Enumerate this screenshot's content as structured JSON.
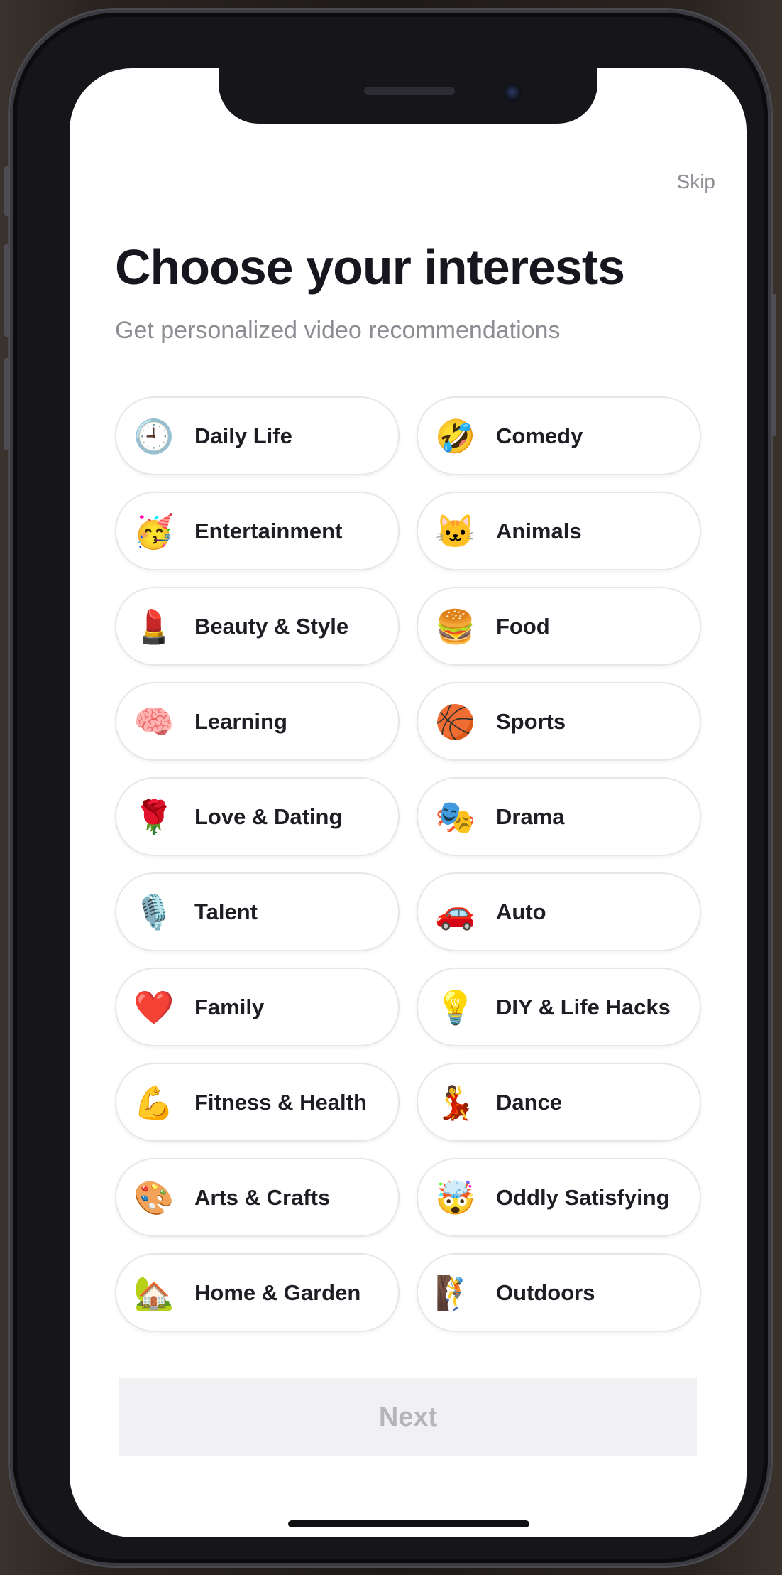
{
  "header": {
    "skip_label": "Skip",
    "title": "Choose your interests",
    "subtitle": "Get personalized video recommendations"
  },
  "interests": [
    {
      "label": "Daily Life",
      "emoji": "🕘",
      "icon": "clock-icon"
    },
    {
      "label": "Comedy",
      "emoji": "🤣",
      "icon": "laughing-face-icon"
    },
    {
      "label": "Entertainment",
      "emoji": "🥳",
      "icon": "party-face-icon"
    },
    {
      "label": "Animals",
      "emoji": "🐱",
      "icon": "cat-face-icon"
    },
    {
      "label": "Beauty & Style",
      "emoji": "💄",
      "icon": "lipstick-icon"
    },
    {
      "label": "Food",
      "emoji": "🍔",
      "icon": "burger-icon"
    },
    {
      "label": "Learning",
      "emoji": "🧠",
      "icon": "brain-icon"
    },
    {
      "label": "Sports",
      "emoji": "🏀",
      "icon": "basketball-icon"
    },
    {
      "label": "Love & Dating",
      "emoji": "🌹",
      "icon": "rose-icon"
    },
    {
      "label": "Drama",
      "emoji": "🎭",
      "icon": "theater-masks-icon"
    },
    {
      "label": "Talent",
      "emoji": "🎙️",
      "icon": "microphone-icon"
    },
    {
      "label": "Auto",
      "emoji": "🚗",
      "icon": "car-icon"
    },
    {
      "label": "Family",
      "emoji": "❤️",
      "icon": "heart-icon"
    },
    {
      "label": "DIY & Life Hacks",
      "emoji": "💡",
      "icon": "light-bulb-icon"
    },
    {
      "label": "Fitness & Health",
      "emoji": "💪",
      "icon": "flexed-bicep-icon"
    },
    {
      "label": "Dance",
      "emoji": "💃",
      "icon": "dancer-icon"
    },
    {
      "label": "Arts & Crafts",
      "emoji": "🎨",
      "icon": "palette-icon"
    },
    {
      "label": "Oddly Satisfying",
      "emoji": "🤯",
      "icon": "exploding-head-icon"
    },
    {
      "label": "Home & Garden",
      "emoji": "🏡",
      "icon": "house-garden-icon"
    },
    {
      "label": "Outdoors",
      "emoji": "🧗",
      "icon": "climber-icon"
    }
  ],
  "footer": {
    "next_label": "Next"
  }
}
